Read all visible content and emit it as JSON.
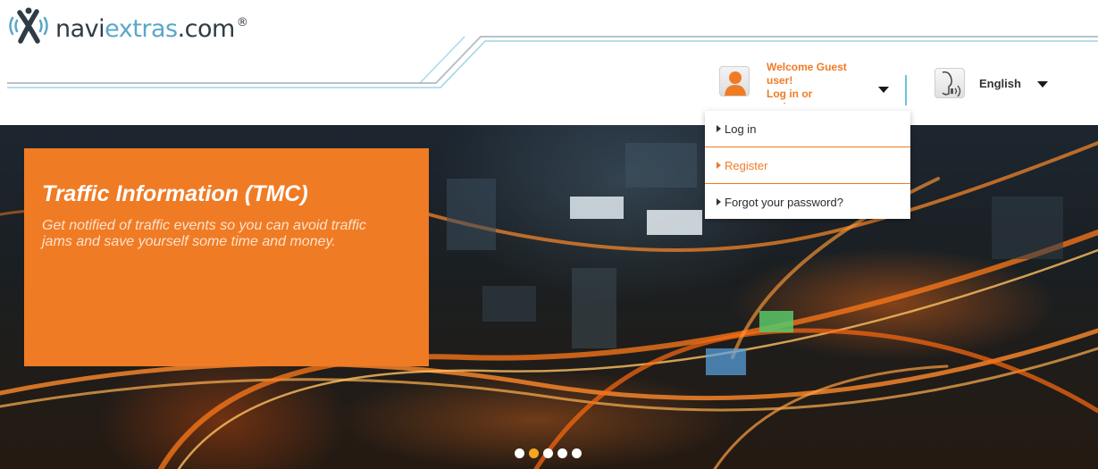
{
  "logo": {
    "name_part1": "navi",
    "name_part2": "extras",
    "name_part3": ".com",
    "registered": "®"
  },
  "user": {
    "welcome": "Welcome Guest user!",
    "login_link": "Log in or",
    "register_link": "register"
  },
  "language": {
    "current": "English"
  },
  "dropdown": {
    "items": [
      {
        "label": "Log in"
      },
      {
        "label": "Register"
      },
      {
        "label": "Forgot your password?"
      }
    ]
  },
  "hero": {
    "title": "Traffic Information (TMC)",
    "description": "Get notified of traffic events so you can avoid traffic jams and save yourself some time and money.",
    "slides_total": 5,
    "active_slide": 2
  },
  "colors": {
    "accent": "#f07b25",
    "brand_blue": "#5aa7c8",
    "separator": "#6cc1dc"
  }
}
